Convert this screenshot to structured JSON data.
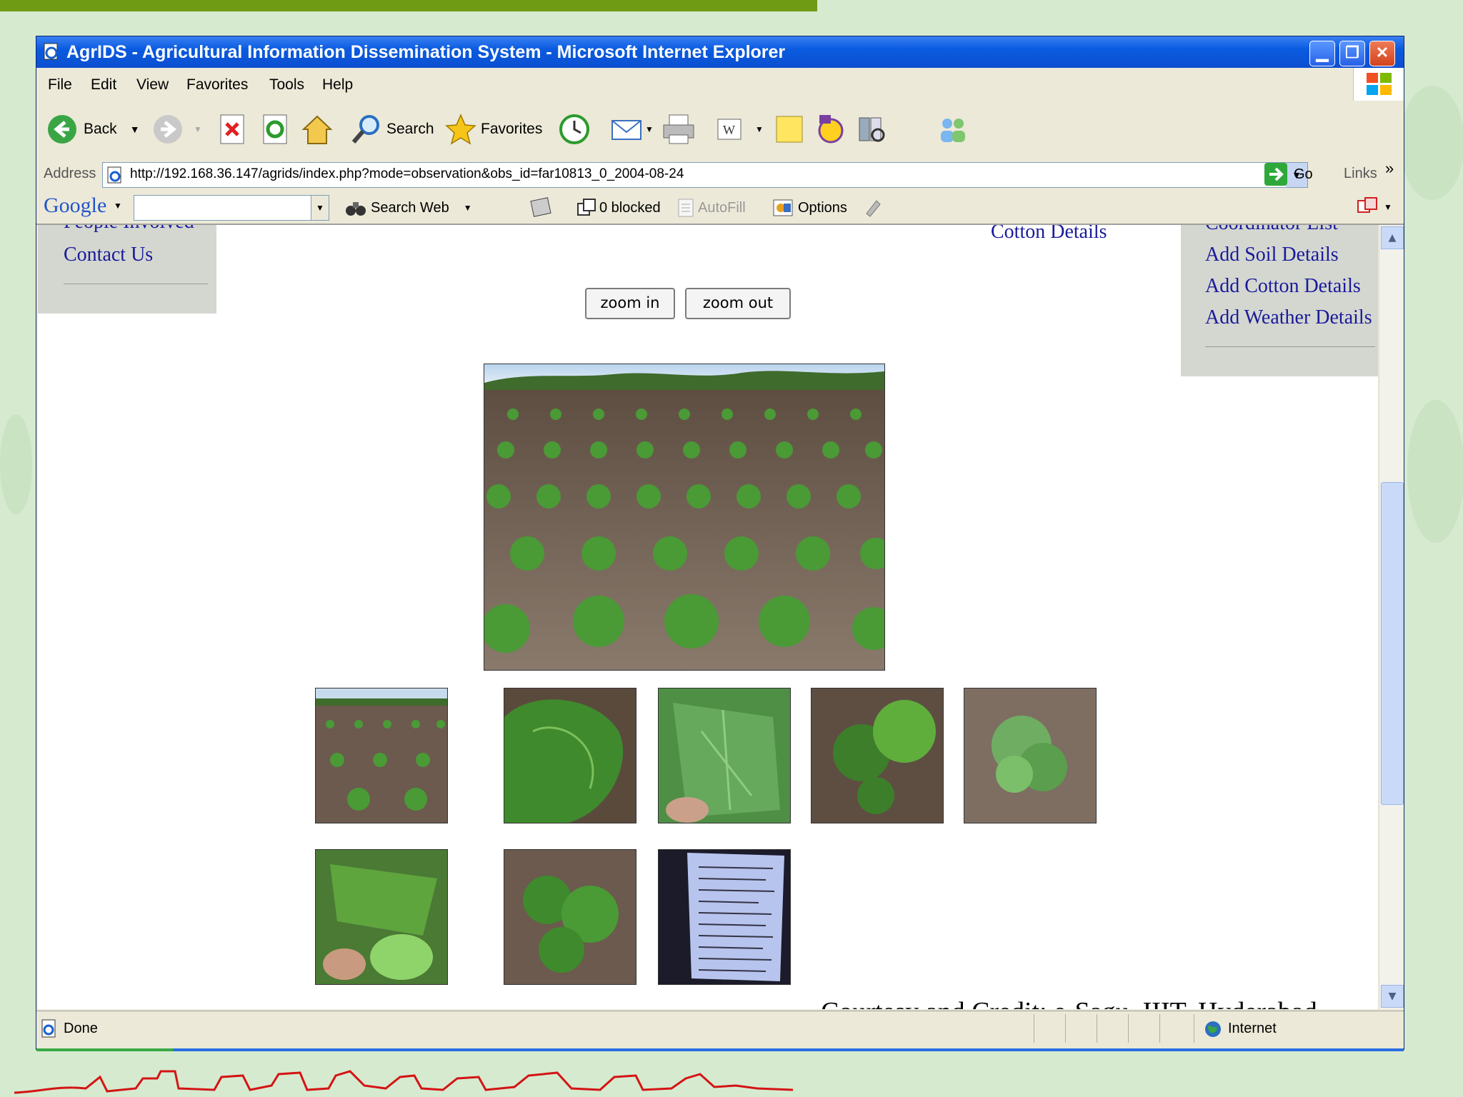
{
  "window": {
    "title": "AgrIDS - Agricultural Information Dissemination System - Microsoft Internet Explorer"
  },
  "menu": [
    "File",
    "Edit",
    "View",
    "Favorites",
    "Tools",
    "Help"
  ],
  "toolbar": {
    "back": "Back",
    "search": "Search",
    "favorites": "Favorites"
  },
  "address": {
    "label": "Address",
    "url": "http://192.168.36.147/agrids/index.php?mode=observation&obs_id=far10813_0_2004-08-24",
    "go": "Go",
    "links": "Links"
  },
  "googlebar": {
    "logo": "Google",
    "search_web": "Search Web",
    "blocked": "0 blocked",
    "autofill": "AutoFill",
    "options": "Options"
  },
  "leftnav": {
    "items": [
      "People Involved",
      "Contact Us"
    ]
  },
  "centernav": {
    "cotton_details": "Cotton Details"
  },
  "rightnav": {
    "items": [
      "Coordinator List",
      "Add Soil Details",
      "Add Cotton Details",
      "Add Weather Details"
    ]
  },
  "viewer": {
    "zoom_in": "zoom in",
    "zoom_out": "zoom out"
  },
  "credit": "Courtesy and Credit: e-Sagu, IIIT, Hyderabad",
  "status": {
    "text": "Done",
    "zone": "Internet"
  },
  "colors": {
    "link": "#1a1a9c",
    "titlebar": "#0a5be0",
    "slide_accent": "#6e9a14",
    "soil": "#6b5a4d",
    "crop": "#3f8a2d"
  }
}
